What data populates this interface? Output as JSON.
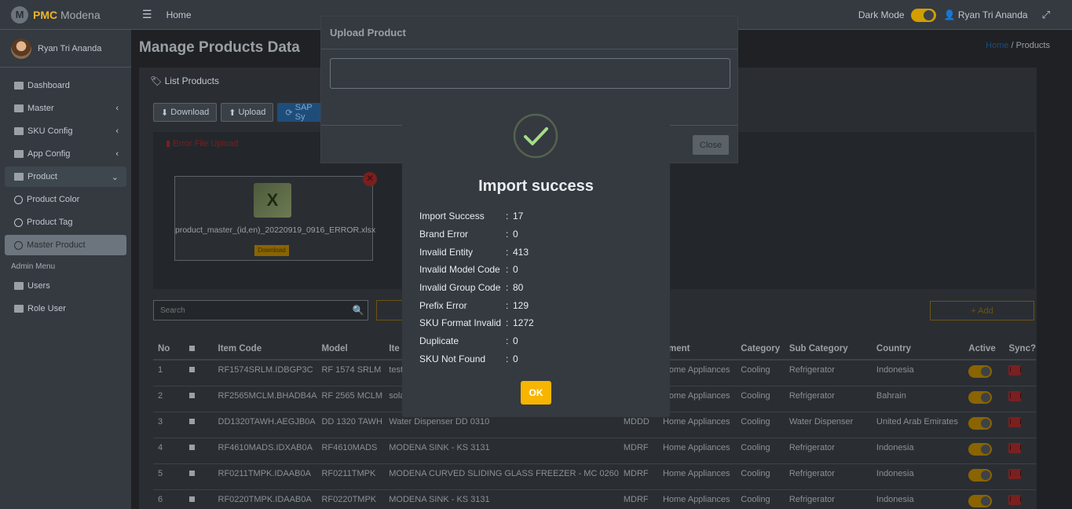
{
  "brand": {
    "logo_letter": "M",
    "strong": "PMC",
    "rest": " Modena"
  },
  "user": {
    "name": "Ryan Tri Ananda"
  },
  "sidebar": {
    "items": [
      {
        "label": "Dashboard",
        "icon": "table-icon"
      },
      {
        "label": "Master",
        "icon": "folder-icon",
        "chevron": "‹"
      },
      {
        "label": "SKU Config",
        "icon": "gear-icon",
        "chevron": "‹"
      },
      {
        "label": "App Config",
        "icon": "gear-icon",
        "chevron": "‹"
      },
      {
        "label": "Product",
        "icon": "box-icon",
        "chevron": "⌄"
      },
      {
        "label": "Product Color",
        "icon": "circle-icon"
      },
      {
        "label": "Product Tag",
        "icon": "circle-icon"
      },
      {
        "label": "Master Product",
        "icon": "circle-icon"
      }
    ],
    "admin_header": "Admin Menu",
    "admin_items": [
      {
        "label": "Users",
        "icon": "users-icon"
      },
      {
        "label": "Role User",
        "icon": "lock-icon"
      }
    ]
  },
  "navbar": {
    "home": "Home",
    "dark_mode_label": "Dark Mode",
    "user": "Ryan Tri Ananda"
  },
  "page": {
    "title": "Manage Products Data",
    "breadcrumb_home": "Home",
    "breadcrumb_sep": "/",
    "breadcrumb_current": "Products"
  },
  "card": {
    "title": "List Products",
    "buttons": {
      "download": "Download",
      "upload": "Upload",
      "sap": "SAP Sy"
    },
    "error_title": "Error File Upload",
    "file_name": "product_master_(id,en)_20220919_0916_ERROR.xlsx",
    "file_download": "Download",
    "search_placeholder": "Search",
    "add": "+ Add"
  },
  "table": {
    "headers": [
      "No",
      "",
      "Item Code",
      "Model",
      "Ite",
      "",
      "gment",
      "Category",
      "Sub Category",
      "Country",
      "Active",
      "Sync?"
    ],
    "rows": [
      [
        "1",
        "RF1574SRLM.IDBGP3C",
        "RF 1574 SRLM",
        "test",
        "",
        "Home Appliances",
        "Cooling",
        "Refrigerator",
        "Indonesia"
      ],
      [
        "2",
        "RF2565MCLM.BHADB4A",
        "RF 2565 MCLM",
        "sola",
        "",
        "Home Appliances",
        "Cooling",
        "Refrigerator",
        "Bahrain"
      ],
      [
        "3",
        "DD1320TAWH.AEGJB0A",
        "DD 1320 TAWH",
        "Water Dispenser DD 0310",
        "MDDD",
        "Home Appliances",
        "Cooling",
        "Water Dispenser",
        "United Arab Emirates"
      ],
      [
        "4",
        "RF4610MADS.IDXAB0A",
        "RF4610MADS",
        "MODENA SINK - KS 3131",
        "MDRF",
        "Home Appliances",
        "Cooling",
        "Refrigerator",
        "Indonesia"
      ],
      [
        "5",
        "RF0211TMPK.IDAAB0A",
        "RF0211TMPK",
        "MODENA CURVED SLIDING GLASS FREEZER - MC 0260",
        "MDRF",
        "Home Appliances",
        "Cooling",
        "Refrigerator",
        "Indonesia"
      ],
      [
        "6",
        "RF0220TMPK.IDAAB0A",
        "RF0220TMPK",
        "MODENA SINK - KS 3131",
        "MDRF",
        "Home Appliances",
        "Cooling",
        "Refrigerator",
        "Indonesia"
      ]
    ]
  },
  "upload_modal": {
    "title": "Upload Product",
    "close": "Close"
  },
  "success_modal": {
    "title": "Import success",
    "rows": [
      {
        "k": "Import Success",
        "v": "17"
      },
      {
        "k": "Brand Error",
        "v": "0"
      },
      {
        "k": "Invalid Entity",
        "v": "413"
      },
      {
        "k": "Invalid Model Code",
        "v": "0"
      },
      {
        "k": "Invalid Group Code",
        "v": "80"
      },
      {
        "k": "Prefix Error",
        "v": "129"
      },
      {
        "k": "SKU Format Invalid",
        "v": "1272"
      },
      {
        "k": "Duplicate",
        "v": "0"
      },
      {
        "k": "SKU Not Found",
        "v": "0"
      }
    ],
    "separator": ":",
    "ok": "OK"
  }
}
